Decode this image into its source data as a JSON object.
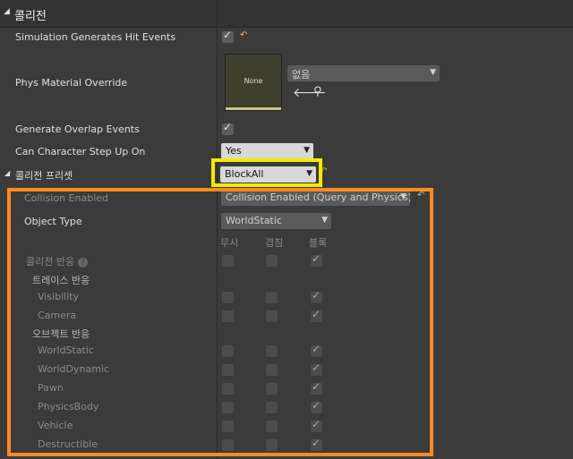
{
  "section_title": "콜리전",
  "props": {
    "sim_hit_events": "Simulation Generates Hit Events",
    "phys_material": "Phys Material Override",
    "overlap_events": "Generate Overlap Events",
    "step_up": "Can Character Step Up On",
    "presets": "콜리전 프리셋"
  },
  "phys_material": {
    "thumbnail": "None",
    "value": "없음"
  },
  "step_up_value": "Yes",
  "preset_value": "BlockAll",
  "collision_enabled": {
    "label": "Collision Enabled",
    "value": "Collision Enabled (Query and Physics)"
  },
  "object_type": {
    "label": "Object Type",
    "value": "WorldStatic"
  },
  "columns": [
    "무시",
    "겹침",
    "블록"
  ],
  "responses_label": "콜리전 반응",
  "trace_label": "트레이스 반응",
  "object_label": "오브젝트 반응",
  "rows": [
    {
      "name": "Visibility",
      "checks": [
        false,
        false,
        true
      ]
    },
    {
      "name": "Camera",
      "checks": [
        false,
        false,
        true
      ]
    },
    {
      "name": "WorldStatic",
      "checks": [
        false,
        false,
        true
      ]
    },
    {
      "name": "WorldDynamic",
      "checks": [
        false,
        false,
        true
      ]
    },
    {
      "name": "Pawn",
      "checks": [
        false,
        false,
        true
      ]
    },
    {
      "name": "PhysicsBody",
      "checks": [
        false,
        false,
        true
      ]
    },
    {
      "name": "Vehicle",
      "checks": [
        false,
        false,
        true
      ]
    },
    {
      "name": "Destructible",
      "checks": [
        false,
        false,
        true
      ]
    }
  ],
  "colors": {
    "yellow_highlight": "#f0ec00",
    "orange_highlight": "#ff8a1e"
  }
}
